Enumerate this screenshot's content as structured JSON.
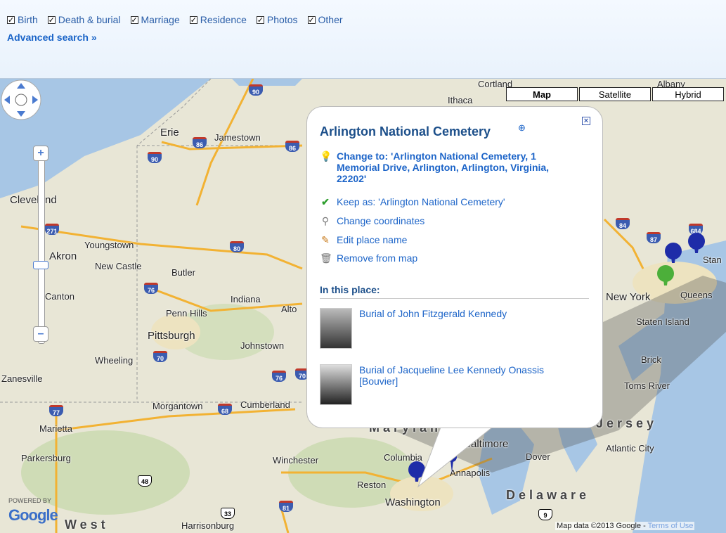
{
  "filters": [
    {
      "label": "Birth",
      "checked": true
    },
    {
      "label": "Death & burial",
      "checked": true
    },
    {
      "label": "Marriage",
      "checked": true
    },
    {
      "label": "Residence",
      "checked": true
    },
    {
      "label": "Photos",
      "checked": true
    },
    {
      "label": "Other",
      "checked": true
    }
  ],
  "advanced_search": "Advanced search »",
  "map": {
    "map_types": [
      "Map",
      "Satellite",
      "Hybrid"
    ],
    "active_type": "Map",
    "labels": [
      "Ithaca",
      "Cortland",
      "Albany",
      "Erie",
      "Jamestown",
      "Cleveland",
      "Youngstown",
      "Akron",
      "New Castle",
      "Butler",
      "Canton",
      "Penn Hills",
      "Indiana",
      "Pittsburgh",
      "Johnstown",
      "Wheeling",
      "Zanesville",
      "Morgantown",
      "Cumberland",
      "Marietta",
      "Parkersburg",
      "Winchester",
      "Columbia",
      "Baltimore",
      "Annapolis",
      "Reston",
      "Washington",
      "Dover",
      "Delaware",
      "Atlantic City",
      "Toms River",
      "Brick",
      "Staten Island",
      "New York",
      "Queens",
      "Jersey",
      "Maryland",
      "West",
      "Alto",
      "Harrisonburg",
      "Stan"
    ],
    "highways": [
      "90",
      "86",
      "86",
      "90",
      "271",
      "80",
      "76",
      "70",
      "76",
      "70",
      "77",
      "68",
      "81",
      "33",
      "48",
      "84",
      "87",
      "684",
      "9"
    ],
    "powered_by": "POWERED BY",
    "google": "Google",
    "map_data": "Map data ©2013 Google -",
    "terms": "Terms of Use"
  },
  "popup": {
    "title": "Arlington National Cemetery",
    "change_to": "Change to: 'Arlington National Cemetery, 1 Memorial Drive, Arlington, Arlington, Virginia, 22202'",
    "keep_as": "Keep as: 'Arlington National Cemetery'",
    "change_coordinates": "Change coordinates",
    "edit_place_name": "Edit place name",
    "remove_from_map": "Remove from map",
    "in_this_place": "In this place:",
    "events": [
      {
        "text": "Burial of John Fitzgerald Kennedy"
      },
      {
        "text": "Burial of Jacqueline Lee Kennedy Onassis [Bouvier]"
      }
    ]
  },
  "colors": {
    "link": "#1c64c8",
    "title": "#1c4f8a",
    "pin_blue": "#1e2ca8",
    "pin_green": "#4caf3a"
  }
}
